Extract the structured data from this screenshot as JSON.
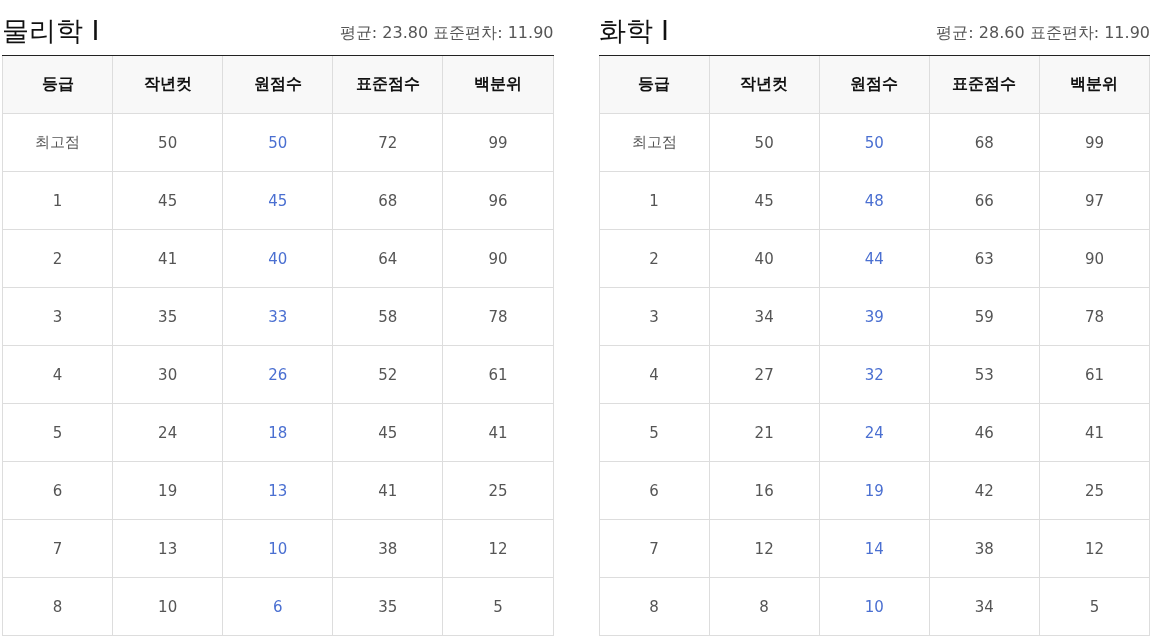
{
  "panels": [
    {
      "title": "물리학 Ⅰ",
      "stats": "평균: 23.80 표준편차: 11.90",
      "columns": [
        {
          "label": "등급",
          "highlight": false
        },
        {
          "label": "작년컷",
          "highlight": false
        },
        {
          "label": "원점수",
          "highlight": true
        },
        {
          "label": "표준점수",
          "highlight": false
        },
        {
          "label": "백분위",
          "highlight": false
        }
      ],
      "rows": [
        [
          "최고점",
          "50",
          "50",
          "72",
          "99"
        ],
        [
          "1",
          "45",
          "45",
          "68",
          "96"
        ],
        [
          "2",
          "41",
          "40",
          "64",
          "90"
        ],
        [
          "3",
          "35",
          "33",
          "58",
          "78"
        ],
        [
          "4",
          "30",
          "26",
          "52",
          "61"
        ],
        [
          "5",
          "24",
          "18",
          "45",
          "41"
        ],
        [
          "6",
          "19",
          "13",
          "41",
          "25"
        ],
        [
          "7",
          "13",
          "10",
          "38",
          "12"
        ],
        [
          "8",
          "10",
          "6",
          "35",
          "5"
        ]
      ]
    },
    {
      "title": "화학 Ⅰ",
      "stats": "평균: 28.60 표준편차: 11.90",
      "columns": [
        {
          "label": "등급",
          "highlight": false
        },
        {
          "label": "작년컷",
          "highlight": false
        },
        {
          "label": "원점수",
          "highlight": true
        },
        {
          "label": "표준점수",
          "highlight": false
        },
        {
          "label": "백분위",
          "highlight": false
        }
      ],
      "rows": [
        [
          "최고점",
          "50",
          "50",
          "68",
          "99"
        ],
        [
          "1",
          "45",
          "48",
          "66",
          "97"
        ],
        [
          "2",
          "40",
          "44",
          "63",
          "90"
        ],
        [
          "3",
          "34",
          "39",
          "59",
          "78"
        ],
        [
          "4",
          "27",
          "32",
          "53",
          "61"
        ],
        [
          "5",
          "21",
          "24",
          "46",
          "41"
        ],
        [
          "6",
          "16",
          "19",
          "42",
          "25"
        ],
        [
          "7",
          "12",
          "14",
          "38",
          "12"
        ],
        [
          "8",
          "8",
          "10",
          "34",
          "5"
        ]
      ]
    }
  ]
}
